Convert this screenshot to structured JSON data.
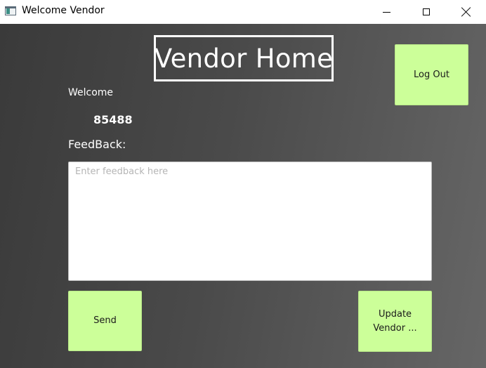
{
  "window": {
    "title": "Welcome Vendor",
    "icons": [
      "app-icon",
      "minimize-icon",
      "maximize-icon",
      "close-icon"
    ]
  },
  "header": {
    "title": "Vendor Home",
    "logout_label": "Log Out"
  },
  "welcome": {
    "label": "Welcome",
    "vendor_id": "85488"
  },
  "feedback": {
    "label": "FeedBack:",
    "placeholder": "Enter feedback here",
    "value": ""
  },
  "actions": {
    "send_label": "Send",
    "update_label": "Update Vendor ..."
  },
  "colors": {
    "button_bg": "#ccff99",
    "background_dark": "#3a3a3a",
    "background_light": "#666666",
    "text": "#ffffff"
  }
}
